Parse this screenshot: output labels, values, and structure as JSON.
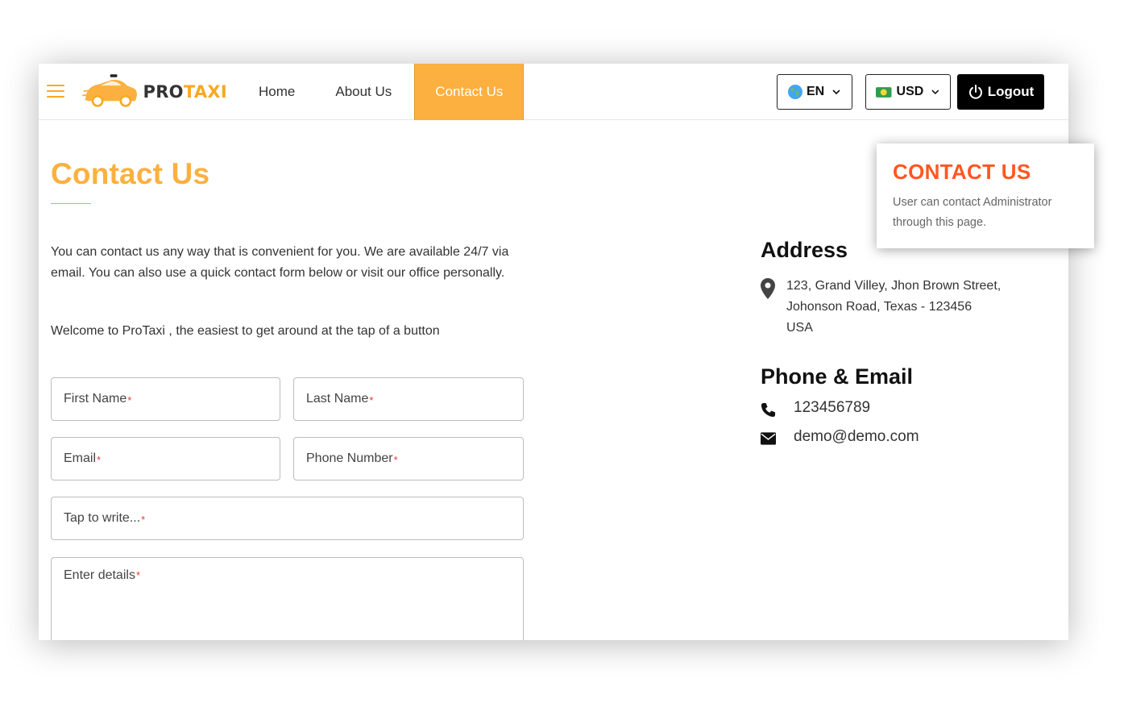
{
  "brand": {
    "pro": "PRO",
    "taxi": "TAXI"
  },
  "nav": {
    "items": [
      {
        "label": "Home"
      },
      {
        "label": "About Us"
      },
      {
        "label": "Contact Us"
      }
    ],
    "active": "Contact Us"
  },
  "header": {
    "language": "EN",
    "currency": "USD",
    "logout": "Logout"
  },
  "page": {
    "title": "Contact Us",
    "intro": "You can contact us any way that is convenient for you. We are available 24/7 via email. You can also use a quick contact form below or visit our office personally.",
    "welcome": "Welcome to ProTaxi , the easiest to get around at the tap of a button"
  },
  "form": {
    "first_name": "First Name",
    "last_name": "Last Name",
    "email": "Email",
    "phone": "Phone Number",
    "subject": "Tap to write...",
    "details": "Enter details",
    "required_mark": "*"
  },
  "contact": {
    "address_title": "Address",
    "address_lines": [
      "123, Grand Villey, Jhon Brown Street,",
      "Johonson Road, Texas - 123456",
      "USA"
    ],
    "phone_email_title": "Phone & Email",
    "phone": "123456789",
    "email": "demo@demo.com"
  },
  "callout": {
    "title": "CONTACT US",
    "body": "User can contact Administrator through this page."
  },
  "colors": {
    "accent": "#fbb040",
    "callout_title": "#ff5722",
    "required": "#e53935"
  }
}
